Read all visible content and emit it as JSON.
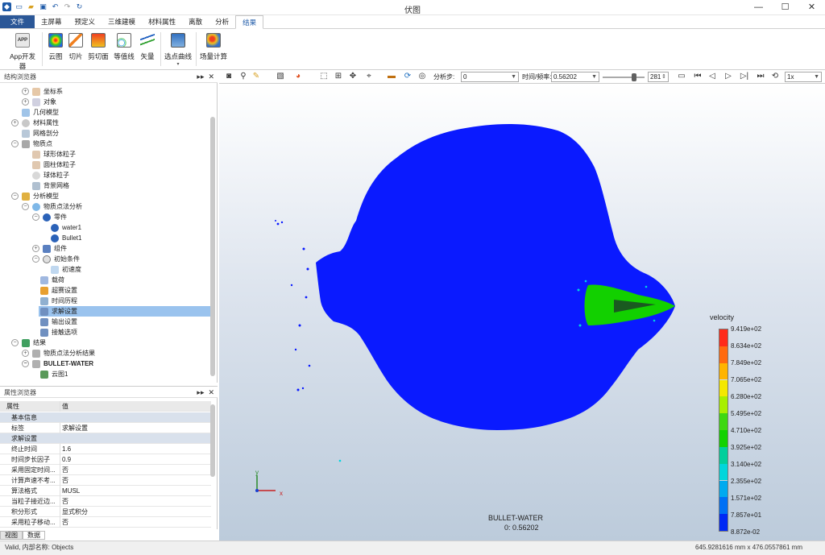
{
  "window": {
    "title": "伏图",
    "min": "—",
    "max": "☐",
    "close": "✕"
  },
  "tabs": [
    {
      "label": "文件"
    },
    {
      "label": "主屏幕"
    },
    {
      "label": "预定义"
    },
    {
      "label": "三维建模"
    },
    {
      "label": "材料属性"
    },
    {
      "label": "离散"
    },
    {
      "label": "分析"
    },
    {
      "label": "结果"
    }
  ],
  "ribbon": {
    "app_dev": "App开发器",
    "contour": "云图",
    "slice": "切片",
    "clip": "剪切面",
    "isoline": "等值线",
    "vector": "矢量",
    "pick_curve": "选点曲线",
    "field_calc": "场量计算"
  },
  "tree_panel": {
    "title": "结构浏览器"
  },
  "tree": [
    {
      "label": "坐标系"
    },
    {
      "label": "对象"
    },
    {
      "label": "几何模型"
    },
    {
      "label": "材料属性"
    },
    {
      "label": "网格剖分"
    },
    {
      "label": "物质点"
    },
    {
      "label": "球形体粒子"
    },
    {
      "label": "圆柱体粒子"
    },
    {
      "label": "球体粒子"
    },
    {
      "label": "背景网格"
    },
    {
      "label": "分析模型"
    },
    {
      "label": "物质点法分析"
    },
    {
      "label": "零件"
    },
    {
      "label": "water1"
    },
    {
      "label": "Bullet1"
    },
    {
      "label": "组件"
    },
    {
      "label": "初始条件"
    },
    {
      "label": "初速度"
    },
    {
      "label": "载荷"
    },
    {
      "label": "超赛设置"
    },
    {
      "label": "时间历程"
    },
    {
      "label": "求解设置"
    },
    {
      "label": "输出设置"
    },
    {
      "label": "接触选项"
    },
    {
      "label": "结果"
    },
    {
      "label": "物质点法分析结果"
    },
    {
      "label": "BULLET-WATER"
    },
    {
      "label": "云图1"
    }
  ],
  "props_panel": {
    "title": "属性浏览器",
    "col_key": "属性",
    "col_val": "值",
    "sections": [
      {
        "title": "基本信息",
        "rows": [
          {
            "k": "标签",
            "v": "求解设置"
          }
        ]
      },
      {
        "title": "求解设置",
        "rows": [
          {
            "k": "终止时间",
            "v": "1.6"
          },
          {
            "k": "时间步长因子",
            "v": "0.9"
          },
          {
            "k": "采用固定时间...",
            "v": "否"
          },
          {
            "k": "计算声速不考...",
            "v": "否"
          },
          {
            "k": "算法格式",
            "v": "MUSL"
          },
          {
            "k": "当粒子接近边...",
            "v": "否"
          },
          {
            "k": "积分形式",
            "v": "显式积分"
          },
          {
            "k": "采用粒子移动...",
            "v": "否"
          }
        ]
      }
    ]
  },
  "bottom_tabs": [
    "视图",
    "数据"
  ],
  "viewer_toolbar": {
    "step_label": "分析步:",
    "step_value": "0",
    "time_label": "时间/频率:",
    "time_value": "0.56202",
    "frame_value": "281",
    "speed_value": "1x"
  },
  "viewport": {
    "caption_name": "BULLET-WATER",
    "caption_time": "0: 0.56202",
    "axis_y": "y",
    "axis_x": "x"
  },
  "legend": {
    "title": "velocity",
    "labels": [
      "9.419e+02",
      "8.634e+02",
      "7.849e+02",
      "7.065e+02",
      "6.280e+02",
      "5.495e+02",
      "4.710e+02",
      "3.925e+02",
      "3.140e+02",
      "2.355e+02",
      "1.571e+02",
      "7.857e+01",
      "8.872e-02"
    ],
    "colors": [
      "#ff2a1a",
      "#ff6a10",
      "#ffb400",
      "#f4e800",
      "#a8ef00",
      "#3ed810",
      "#12d200",
      "#00cf9c",
      "#00d6dc",
      "#00aaf0",
      "#0070f5",
      "#0028f5"
    ]
  },
  "status": {
    "left": "Valid, 内部名称: Objects",
    "right": "645.9281616 mm x 476.0557861 mm"
  }
}
